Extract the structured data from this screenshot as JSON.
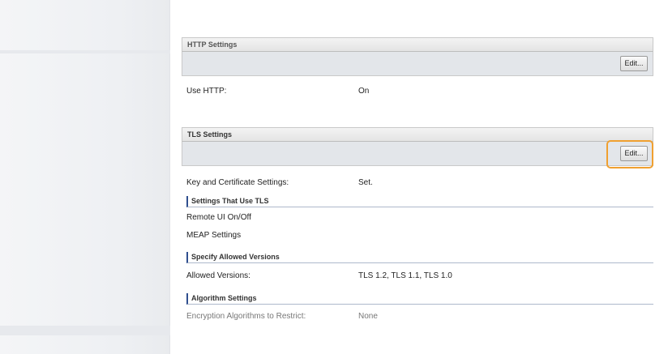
{
  "http_section": {
    "title": "HTTP Settings",
    "edit_label": "Edit...",
    "rows": [
      {
        "label": "Use HTTP:",
        "value": "On"
      }
    ]
  },
  "tls_section": {
    "title": "TLS Settings",
    "edit_label": "Edit...",
    "rows": [
      {
        "label": "Key and Certificate Settings:",
        "value": "Set."
      }
    ],
    "subsections": [
      {
        "title": "Settings That Use TLS",
        "items": [
          "Remote UI On/Off",
          "MEAP Settings"
        ]
      },
      {
        "title": "Specify Allowed Versions",
        "rows": [
          {
            "label": "Allowed Versions:",
            "value": "TLS 1.2, TLS 1.1, TLS 1.0"
          }
        ]
      },
      {
        "title": "Algorithm Settings",
        "rows": [
          {
            "label": "Encryption Algorithms to Restrict:",
            "value": "None"
          }
        ]
      }
    ]
  },
  "colors": {
    "highlight": "#f0a030",
    "subheading_accent": "#2f4f8f"
  }
}
